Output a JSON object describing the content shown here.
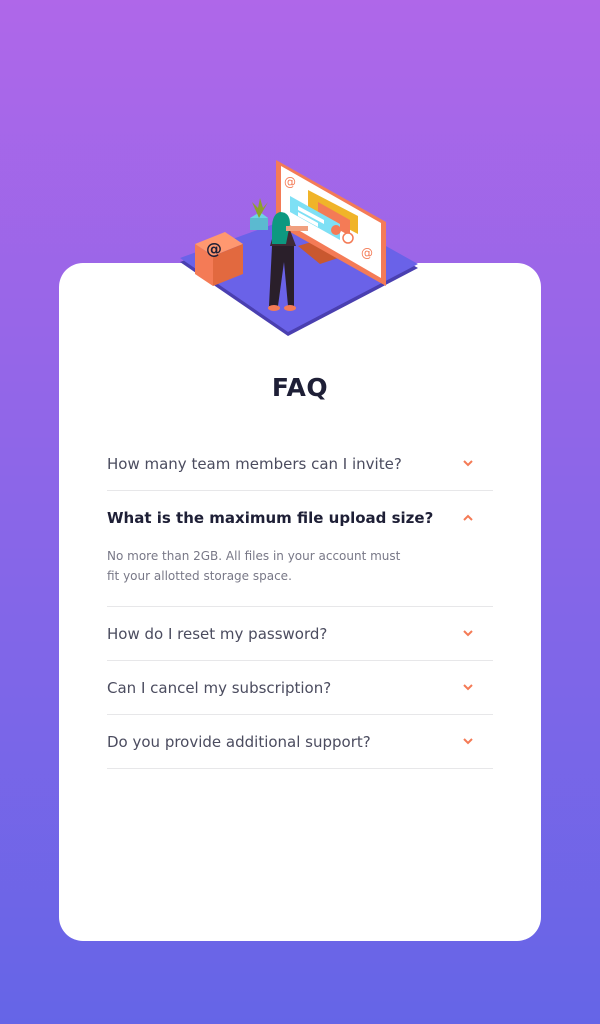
{
  "title": "FAQ",
  "faq": [
    {
      "question": "How many team members can I invite?",
      "open": false
    },
    {
      "question": "What is the maximum file upload size?",
      "open": true,
      "answer": "No more than 2GB. All files in your account must fit your allotted storage space."
    },
    {
      "question": "How do I reset my password?",
      "open": false
    },
    {
      "question": "Can I cancel my subscription?",
      "open": false
    },
    {
      "question": "Do you provide additional support?",
      "open": false
    }
  ],
  "colors": {
    "accent": "#f47b56",
    "background_top": "#af67e9",
    "background_bottom": "#6565e7",
    "heading": "#1e1f36",
    "question": "#4b4c5f",
    "answer": "#787887"
  },
  "icons": {
    "collapsed": "chevron-down-icon",
    "expanded": "chevron-up-icon"
  }
}
